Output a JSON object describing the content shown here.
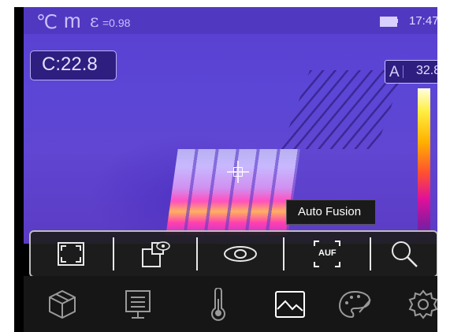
{
  "status_bar": {
    "unit_symbol": "℃",
    "mode_letter": "m",
    "emissivity_symbol": "ε",
    "emissivity_value": "=0.98",
    "time": "17:47"
  },
  "center_measurement": {
    "label": "C:22.8"
  },
  "scale": {
    "mode": "A",
    "max_value": "32.8"
  },
  "tooltip": {
    "text": "Auto Fusion"
  },
  "submenu": {
    "items": [
      {
        "icon": "fullscreen-icon"
      },
      {
        "icon": "picture-in-picture-icon"
      },
      {
        "icon": "visible-eye-icon"
      },
      {
        "icon": "auto-fusion-icon",
        "label": "AUF",
        "selected": true
      },
      {
        "icon": "magnifier-icon"
      }
    ]
  },
  "main_menu": {
    "items": [
      {
        "icon": "box-icon"
      },
      {
        "icon": "monitor-icon"
      },
      {
        "icon": "thermometer-icon"
      },
      {
        "icon": "image-icon",
        "selected": true
      },
      {
        "icon": "palette-icon"
      },
      {
        "icon": "settings-gear-icon"
      }
    ]
  },
  "colors": {
    "background": "#5a3ed0",
    "accent": "#ffffff",
    "bar": "#161616"
  }
}
